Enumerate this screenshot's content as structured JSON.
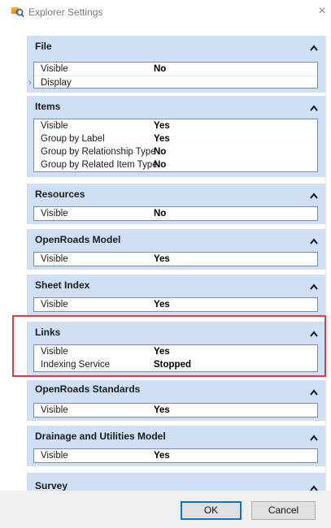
{
  "window": {
    "title": "Explorer Settings",
    "close_glyph": "×"
  },
  "sections": [
    {
      "title": "File",
      "rows": [
        {
          "label": "Visible",
          "value": "No"
        },
        {
          "label": "Display",
          "value": ""
        }
      ]
    },
    {
      "title": "Items",
      "rows": [
        {
          "label": "Visible",
          "value": "Yes"
        },
        {
          "label": "Group by Label",
          "value": "Yes"
        },
        {
          "label": "Group by Relationship Type",
          "value": "No"
        },
        {
          "label": "Group by Related Item Type",
          "value": "No"
        }
      ]
    },
    {
      "title": "Resources",
      "rows": [
        {
          "label": "Visible",
          "value": "No"
        }
      ]
    },
    {
      "title": "OpenRoads Model",
      "rows": [
        {
          "label": "Visible",
          "value": "Yes"
        }
      ]
    },
    {
      "title": "Sheet Index",
      "rows": [
        {
          "label": "Visible",
          "value": "Yes"
        }
      ]
    },
    {
      "title": "Links",
      "rows": [
        {
          "label": "Visible",
          "value": "Yes"
        },
        {
          "label": "Indexing Service",
          "value": "Stopped"
        }
      ]
    },
    {
      "title": "OpenRoads Standards",
      "rows": [
        {
          "label": "Visible",
          "value": "Yes"
        }
      ]
    },
    {
      "title": "Drainage and Utilities Model",
      "rows": [
        {
          "label": "Visible",
          "value": "Yes"
        }
      ]
    },
    {
      "title": "Survey",
      "rows": []
    }
  ],
  "buttons": {
    "ok": "OK",
    "cancel": "Cancel"
  },
  "colors": {
    "section_header": "#cfe0f4",
    "highlight_border": "#e03c3c",
    "default_button_border": "#0078d7"
  },
  "icons": {
    "app": "explorer-settings-icon",
    "section_toggle": "chevron-up-icon",
    "expander": "chevron-right-icon"
  }
}
